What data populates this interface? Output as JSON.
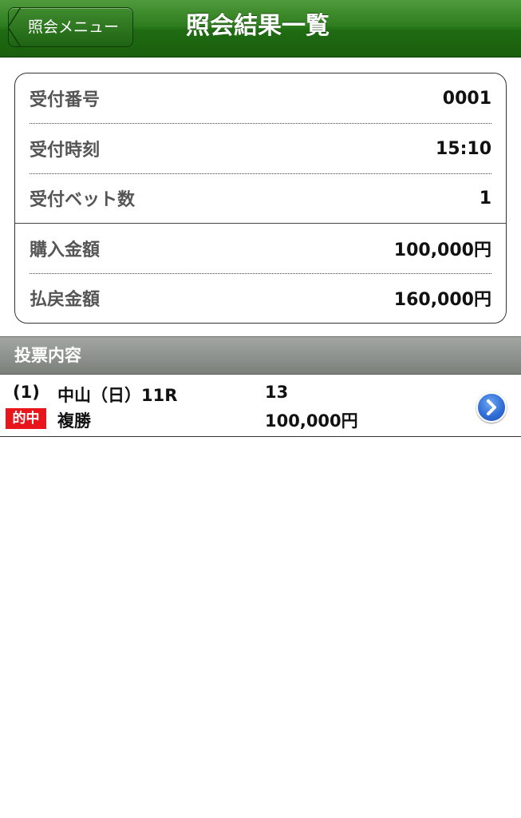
{
  "navbar": {
    "back_label": "照会メニュー",
    "title": "照会結果一覧"
  },
  "summary": {
    "rows": [
      {
        "label": "受付番号",
        "value": "0001"
      },
      {
        "label": "受付時刻",
        "value": "15:10"
      },
      {
        "label": "受付ベット数",
        "value": "1"
      },
      {
        "label": "購入金額",
        "value": "100,000円"
      },
      {
        "label": "払戻金額",
        "value": "160,000円"
      }
    ]
  },
  "section": {
    "title": "投票内容"
  },
  "entry": {
    "index": "(1)",
    "race": "中山（日）11R",
    "selection": "13",
    "badge": "的中",
    "bet_type": "複勝",
    "amount": "100,000円",
    "detail_icon": "chevron-right-icon"
  },
  "colors": {
    "navbar_green": "#2e7d1e",
    "badge_red": "#e8151b",
    "detail_blue": "#2f6fd8"
  }
}
